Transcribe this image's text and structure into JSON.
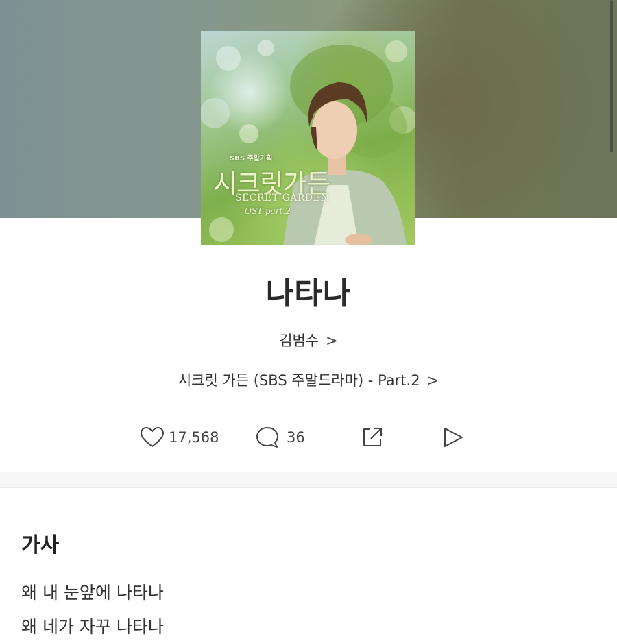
{
  "song": {
    "title": "나타나",
    "artist": "김범수",
    "album": "시크릿 가든 (SBS 주말드라마) - Part.2"
  },
  "album_art": {
    "network": "SBS 주말기획",
    "title_korean": "시크릿가든",
    "title_english": "SECRET GARDEN",
    "ost_label": "OST part.2"
  },
  "actions": {
    "likes": "17,568",
    "comments": "36"
  },
  "icons": {
    "like": "heart-icon",
    "comment": "comment-bubble-icon",
    "share": "share-icon",
    "play": "play-icon",
    "chevron": "chevron-right-icon"
  },
  "lyrics": {
    "heading": "가사",
    "lines": [
      "왜 내 눈앞에 나타나",
      "왜 네가 자꾸 나타나"
    ]
  },
  "colors": {
    "text_primary": "#2a2a2a",
    "divider": "#f6f6f6"
  }
}
